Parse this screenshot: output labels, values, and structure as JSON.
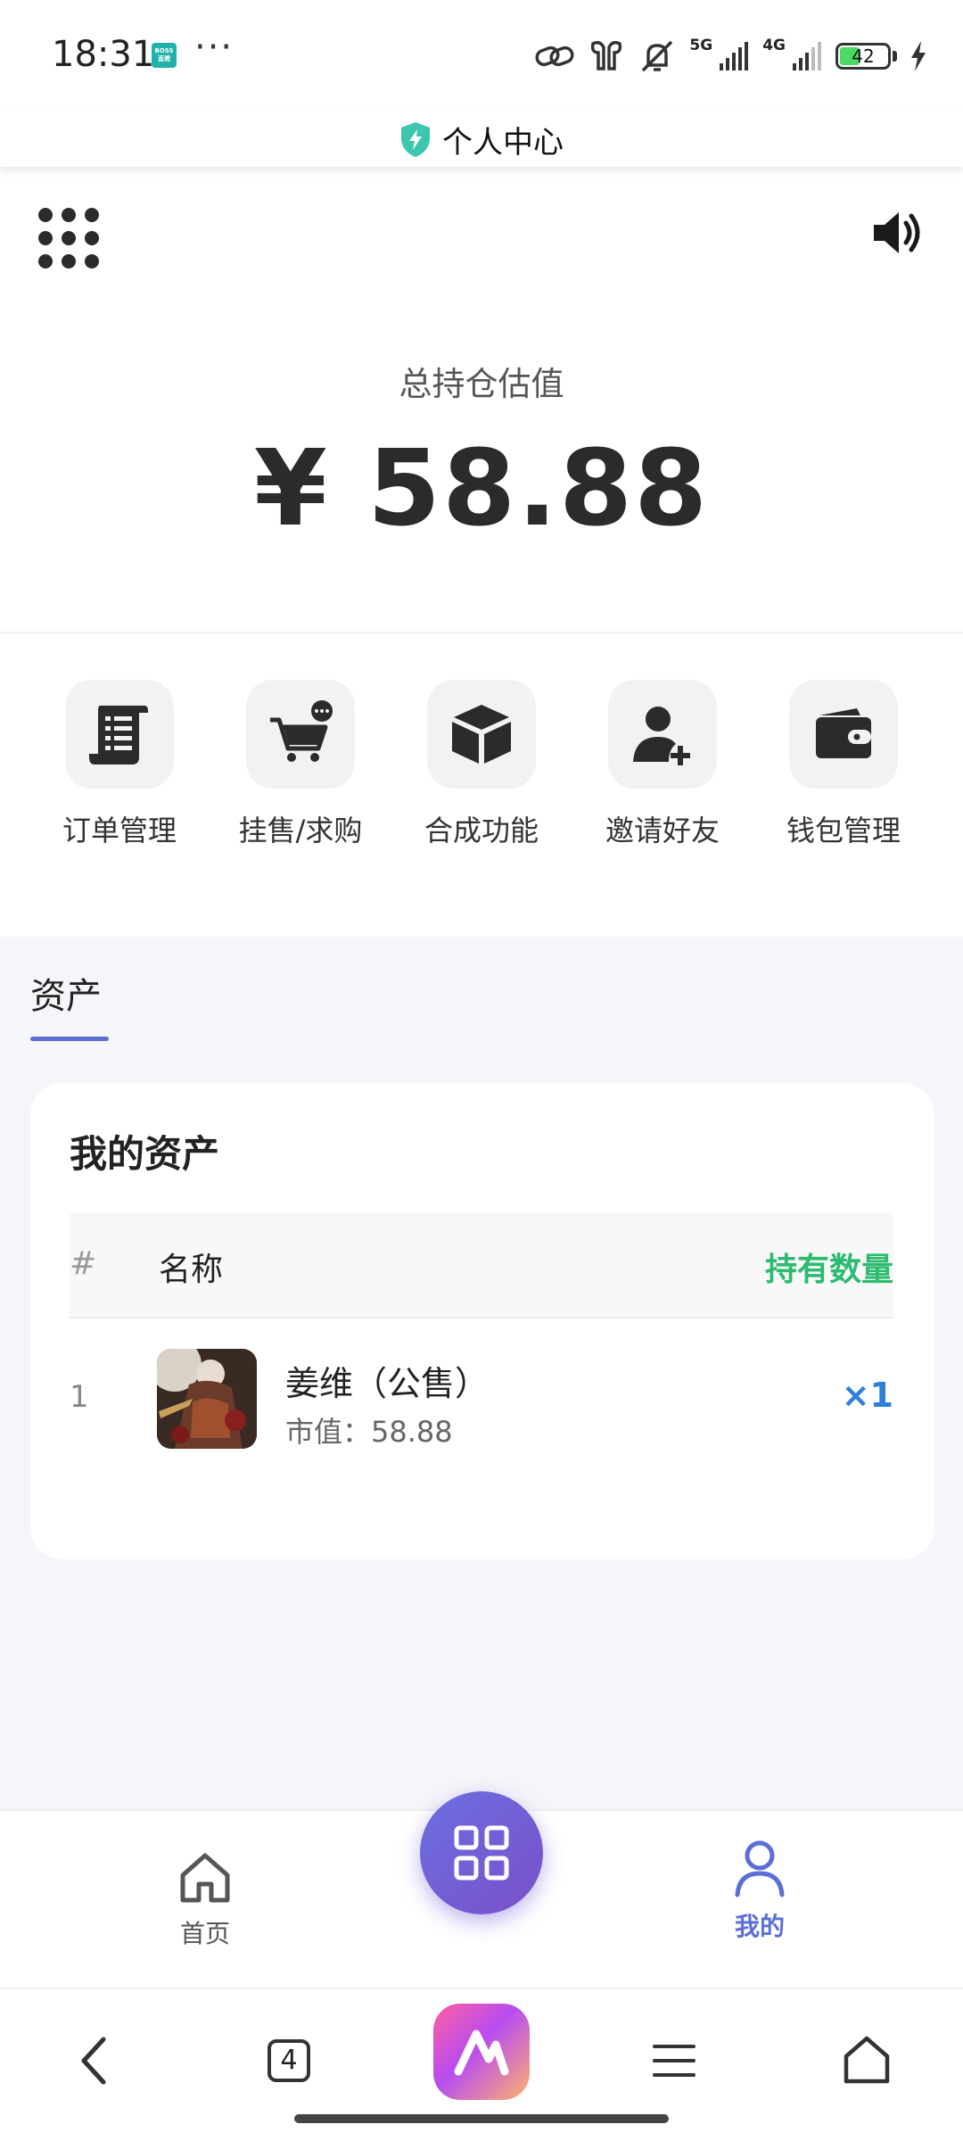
{
  "status_bar": {
    "time": "18:31",
    "app_badge_label": "BOSS直聘",
    "more": "···",
    "network_1": "5G",
    "network_2": "4G",
    "battery": "42"
  },
  "header": {
    "title": "个人中心",
    "icon": "shield-bolt-icon",
    "accent_color": "#3cc6b0"
  },
  "top_tools": {
    "menu_icon": "grid-dots-icon",
    "sound_icon": "speaker-icon"
  },
  "valuation": {
    "label": "总持仓估值",
    "amount": "¥ 58.88"
  },
  "actions": [
    {
      "label": "订单管理",
      "icon": "scroll-list-icon"
    },
    {
      "label": "挂售/求购",
      "icon": "cart-chat-icon"
    },
    {
      "label": "合成功能",
      "icon": "box-cube-icon"
    },
    {
      "label": "邀请好友",
      "icon": "user-add-icon"
    },
    {
      "label": "钱包管理",
      "icon": "wallet-icon"
    }
  ],
  "assets": {
    "tab_label": "资产",
    "card_title": "我的资产",
    "columns": {
      "index": "#",
      "name": "名称",
      "quantity": "持有数量"
    },
    "rows": [
      {
        "index": "1",
        "name": "姜维（公售）",
        "price_label": "市值：",
        "price": "58.88",
        "quantity": "×1"
      }
    ],
    "quantity_color": "#2dbb6f",
    "accent_color": "#5b6fd6"
  },
  "bottom_nav": {
    "home_label": "首页",
    "mine_label": "我的",
    "center_icon": "apps-grid-icon"
  },
  "browser_bar": {
    "tab_count": "4",
    "back_icon": "back-chevron-icon",
    "menu_icon": "hamburger-icon",
    "home_icon": "home-outline-icon"
  }
}
